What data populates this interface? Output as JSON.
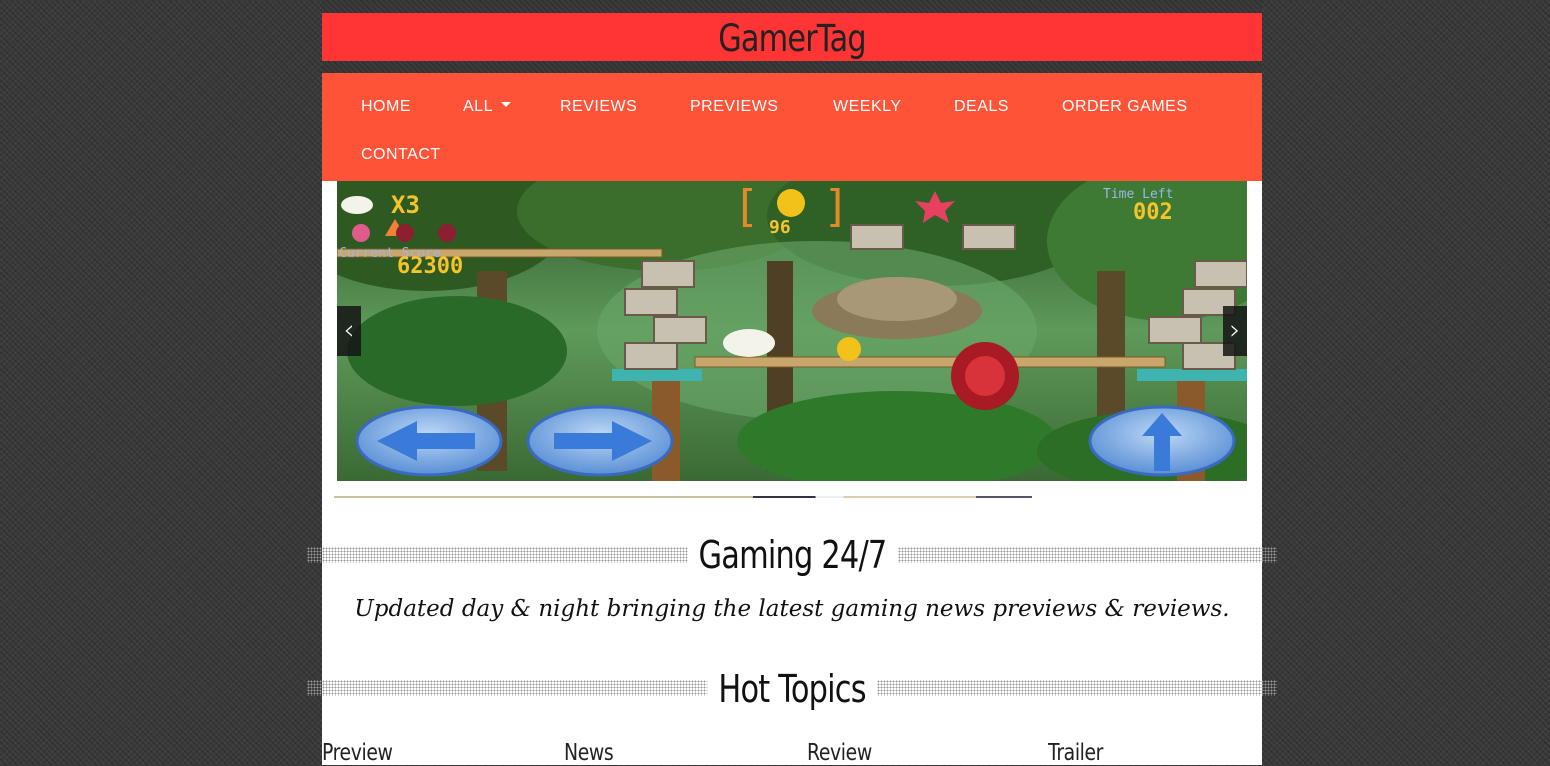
{
  "site": {
    "title": "GamerTag"
  },
  "nav": {
    "items": [
      {
        "label": "HOME"
      },
      {
        "label": "ALL",
        "has_dropdown": true
      },
      {
        "label": "REVIEWS"
      },
      {
        "label": "PREVIEWS"
      },
      {
        "label": "WEEKLY"
      },
      {
        "label": "DEALS"
      },
      {
        "label": "ORDER GAMES"
      },
      {
        "label": "CONTACT"
      }
    ]
  },
  "slider": {
    "prev_icon": "chevron-left-icon",
    "next_icon": "chevron-right-icon",
    "game_hud": {
      "lives": "X3",
      "score_label": "Current Score",
      "score": "62300",
      "coins": "96",
      "time_label": "Time Left",
      "time": "002"
    }
  },
  "intro": {
    "heading": "Gaming 24/7",
    "tagline": "Updated day & night bringing the latest gaming news previews & reviews."
  },
  "hot_topics": {
    "heading": "Hot Topics",
    "items": [
      {
        "label": "Preview"
      },
      {
        "label": "News"
      },
      {
        "label": "Review"
      },
      {
        "label": "Trailer"
      }
    ]
  },
  "colors": {
    "header_bg": "#ff3434",
    "nav_bg": "#ff5338",
    "page_bg": "#3a3a3a",
    "content_bg": "#ffffff"
  }
}
